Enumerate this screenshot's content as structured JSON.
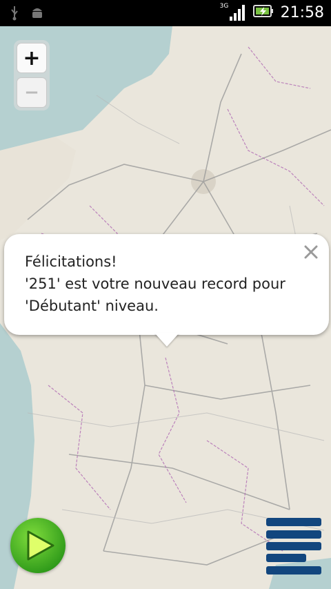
{
  "status_bar": {
    "time": "21:58",
    "network_label": "3G",
    "icons": [
      "usb-icon",
      "android-debug-icon",
      "signal-icon",
      "battery-charging-icon"
    ]
  },
  "map": {
    "zoom_in_label": "+",
    "zoom_out_label": "−"
  },
  "popup": {
    "line1": "Félicitations!",
    "line2": "'251' est votre nouveau record pour",
    "line3": "'Débutant' niveau.",
    "close_icon": "close-icon"
  },
  "controls": {
    "play_icon": "play-icon",
    "menu_icon": "menu-icon"
  },
  "colors": {
    "status_bar_bg": "#000000",
    "land": "#eae6dc",
    "sea": "#b5d0d0",
    "play_green": "#4cbc2a",
    "menu_blue": "#12467e"
  }
}
